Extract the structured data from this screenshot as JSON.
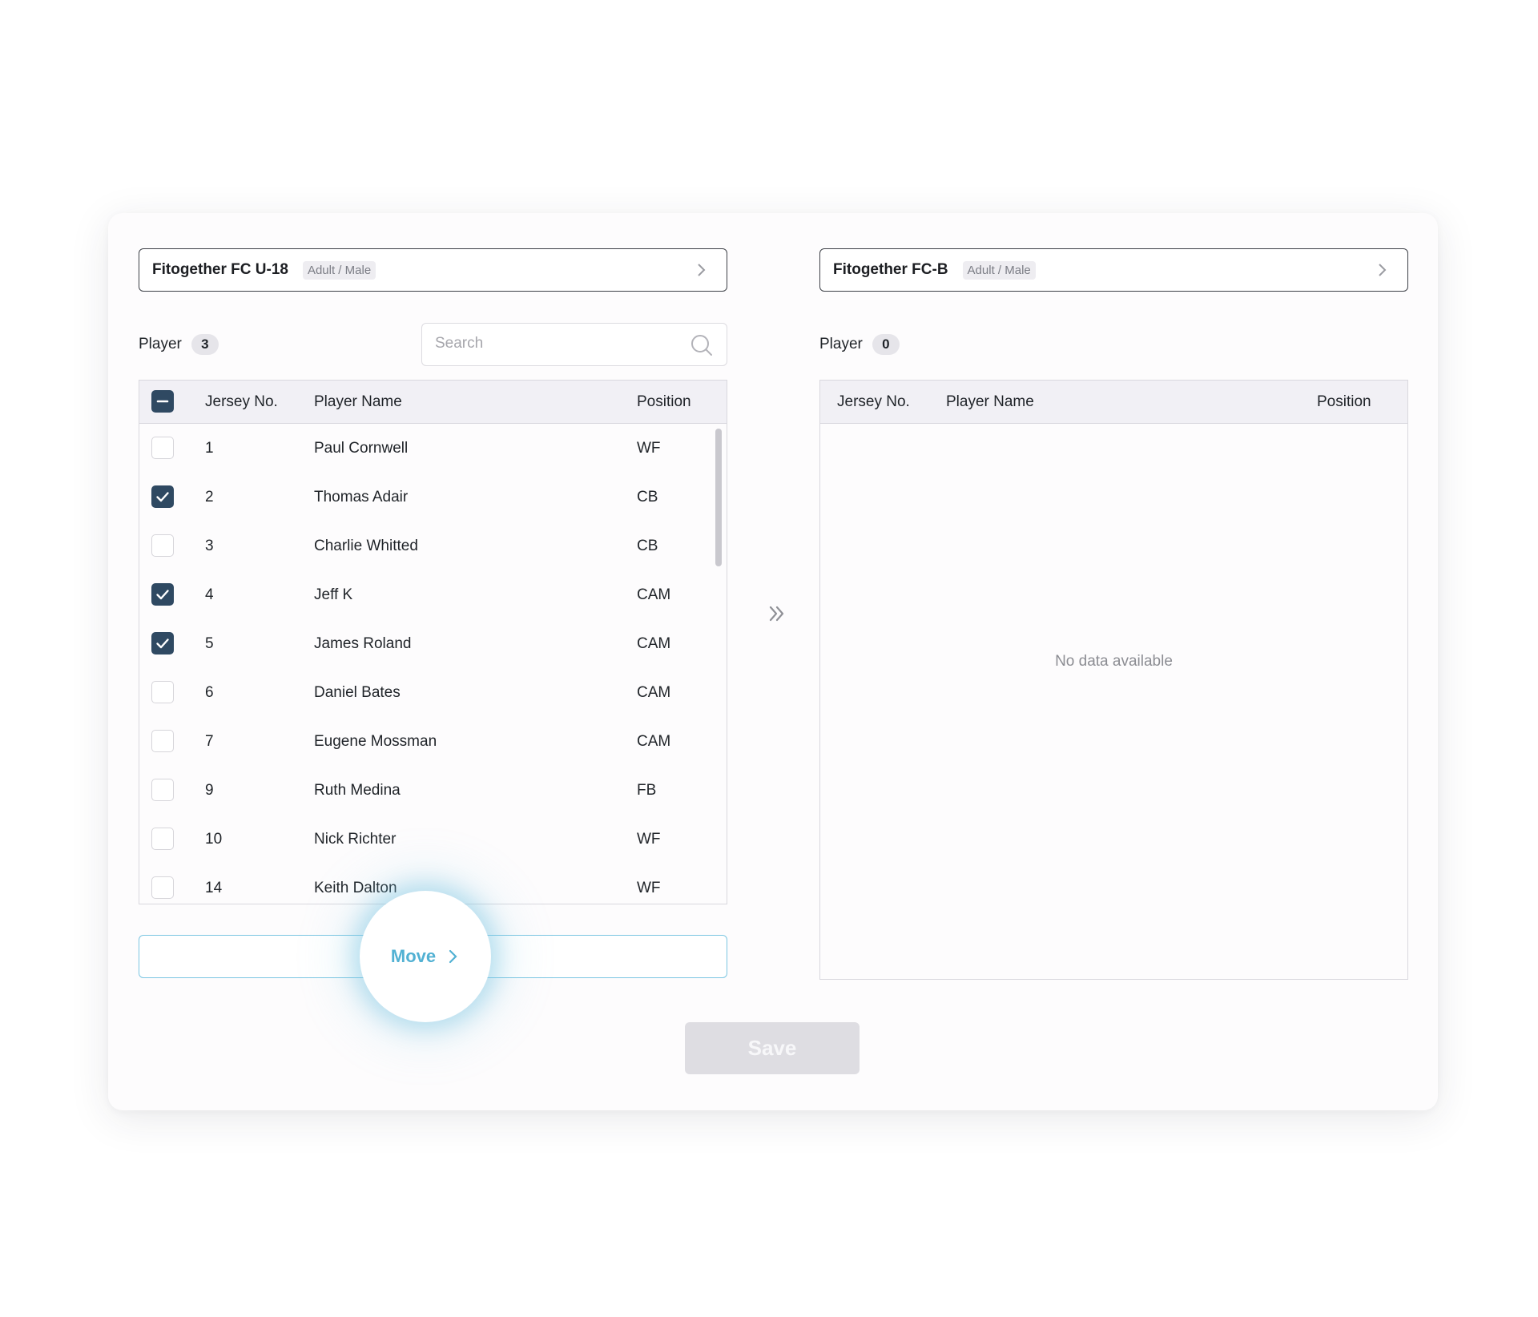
{
  "source_team": {
    "name": "Fitogether FC U-18",
    "tag": "Adult / Male",
    "player_label": "Player",
    "player_count": "3",
    "search_placeholder": "Search",
    "columns": {
      "jersey": "Jersey No.",
      "name": "Player Name",
      "position": "Position"
    },
    "players": [
      {
        "jersey": "1",
        "name": "Paul Cornwell",
        "position": "WF",
        "checked": false
      },
      {
        "jersey": "2",
        "name": "Thomas Adair",
        "position": "CB",
        "checked": true
      },
      {
        "jersey": "3",
        "name": "Charlie Whitted",
        "position": "CB",
        "checked": false
      },
      {
        "jersey": "4",
        "name": "Jeff K",
        "position": "CAM",
        "checked": true
      },
      {
        "jersey": "5",
        "name": "James Roland",
        "position": "CAM",
        "checked": true
      },
      {
        "jersey": "6",
        "name": "Daniel Bates",
        "position": "CAM",
        "checked": false
      },
      {
        "jersey": "7",
        "name": "Eugene Mossman",
        "position": "CAM",
        "checked": false
      },
      {
        "jersey": "9",
        "name": "Ruth Medina",
        "position": "FB",
        "checked": false
      },
      {
        "jersey": "10",
        "name": "Nick Richter",
        "position": "WF",
        "checked": false
      },
      {
        "jersey": "14",
        "name": "Keith Dalton",
        "position": "WF",
        "checked": false
      }
    ]
  },
  "target_team": {
    "name": "Fitogether FC-B",
    "tag": "Adult / Male",
    "player_label": "Player",
    "player_count": "0",
    "columns": {
      "jersey": "Jersey No.",
      "name": "Player Name",
      "position": "Position"
    },
    "empty_text": "No data available"
  },
  "actions": {
    "move_label": "Move",
    "save_label": "Save"
  },
  "colors": {
    "checkbox_checked": "#2f4962",
    "move_accent": "#52b1d3",
    "save_disabled": "#dedde2"
  }
}
